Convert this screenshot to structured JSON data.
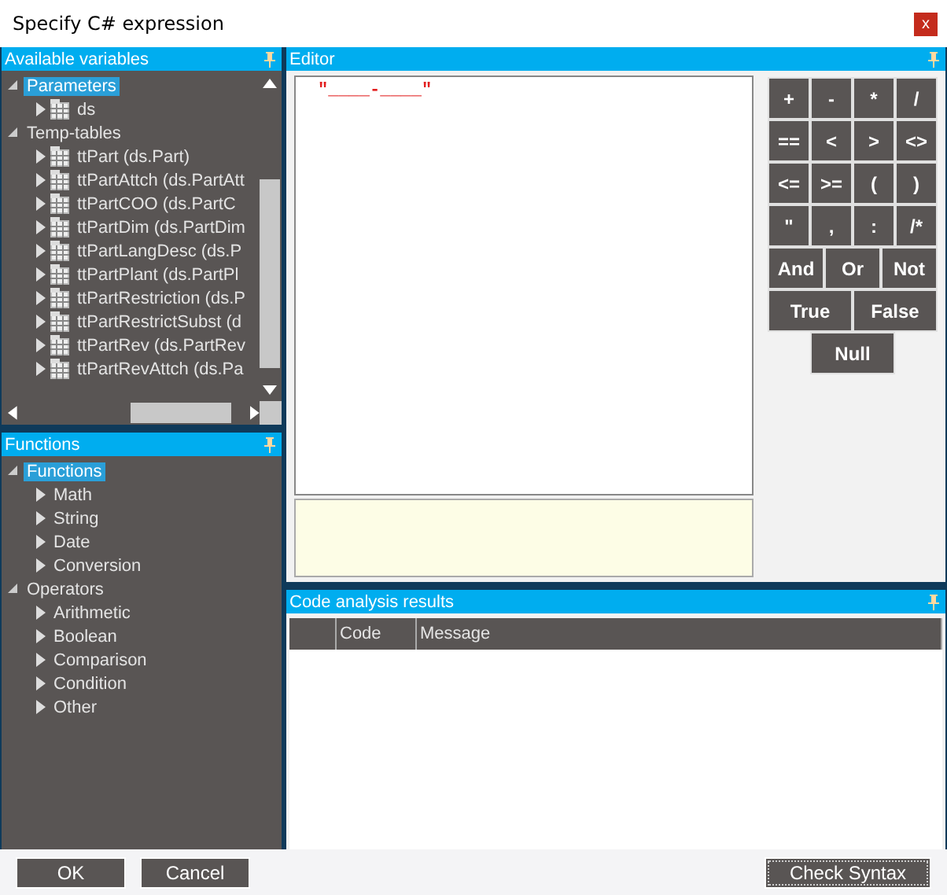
{
  "window": {
    "title": "Specify C# expression",
    "close": "x"
  },
  "variables": {
    "title": "Available variables",
    "tree": [
      {
        "label": "Parameters",
        "expanded": true,
        "selected": true,
        "children": [
          {
            "label": "ds",
            "kind": "table",
            "expanded": false,
            "selected": false
          }
        ]
      },
      {
        "label": "Temp-tables",
        "expanded": true,
        "selected": false,
        "children": [
          {
            "label": "ttPart (ds.Part)",
            "kind": "table",
            "expanded": false,
            "selected": false
          },
          {
            "label": "ttPartAttch (ds.PartAtt",
            "kind": "table",
            "expanded": false,
            "selected": false
          },
          {
            "label": "ttPartCOO (ds.PartC",
            "kind": "table",
            "expanded": false,
            "selected": false
          },
          {
            "label": "ttPartDim (ds.PartDim",
            "kind": "table",
            "expanded": false,
            "selected": false
          },
          {
            "label": "ttPartLangDesc (ds.P",
            "kind": "table",
            "expanded": false,
            "selected": false
          },
          {
            "label": "ttPartPlant (ds.PartPl",
            "kind": "table",
            "expanded": false,
            "selected": false
          },
          {
            "label": "ttPartRestriction (ds.P",
            "kind": "table",
            "expanded": false,
            "selected": false
          },
          {
            "label": "ttPartRestrictSubst (d",
            "kind": "table",
            "expanded": false,
            "selected": false
          },
          {
            "label": "ttPartRev (ds.PartRev",
            "kind": "table",
            "expanded": false,
            "selected": false
          },
          {
            "label": "ttPartRevAttch (ds.Pa",
            "kind": "table",
            "expanded": false,
            "selected": false
          }
        ]
      }
    ]
  },
  "functions": {
    "title": "Functions",
    "tree": [
      {
        "label": "Functions",
        "expanded": true,
        "selected": true,
        "children": [
          {
            "label": "Math",
            "expanded": false,
            "selected": false
          },
          {
            "label": "String",
            "expanded": false,
            "selected": false
          },
          {
            "label": "Date",
            "expanded": false,
            "selected": false
          },
          {
            "label": "Conversion",
            "expanded": false,
            "selected": false
          }
        ]
      },
      {
        "label": "Operators",
        "expanded": true,
        "selected": false,
        "children": [
          {
            "label": "Arithmetic",
            "expanded": false,
            "selected": false
          },
          {
            "label": "Boolean",
            "expanded": false,
            "selected": false
          },
          {
            "label": "Comparison",
            "expanded": false,
            "selected": false
          },
          {
            "label": "Condition",
            "expanded": false,
            "selected": false
          },
          {
            "label": "Other",
            "expanded": false,
            "selected": false
          }
        ]
      }
    ]
  },
  "editor": {
    "title": "Editor",
    "code": "\"____-____\"",
    "keys": [
      [
        "+",
        "-",
        "*",
        "/"
      ],
      [
        "==",
        "<",
        ">",
        "<>"
      ],
      [
        "<=",
        ">=",
        "(",
        ")"
      ],
      [
        "\"",
        ",",
        ":",
        "/*"
      ],
      [
        "And",
        "Or",
        "Not"
      ],
      [
        "True",
        "False"
      ],
      [
        "Null"
      ]
    ]
  },
  "analysis": {
    "title": "Code analysis results",
    "columns": [
      "Code",
      "Message"
    ]
  },
  "buttons": [
    {
      "label": "OK",
      "focused": false
    },
    {
      "label": "Cancel",
      "focused": false
    }
  ],
  "check_button": {
    "label": "Check Syntax",
    "focused": true
  }
}
